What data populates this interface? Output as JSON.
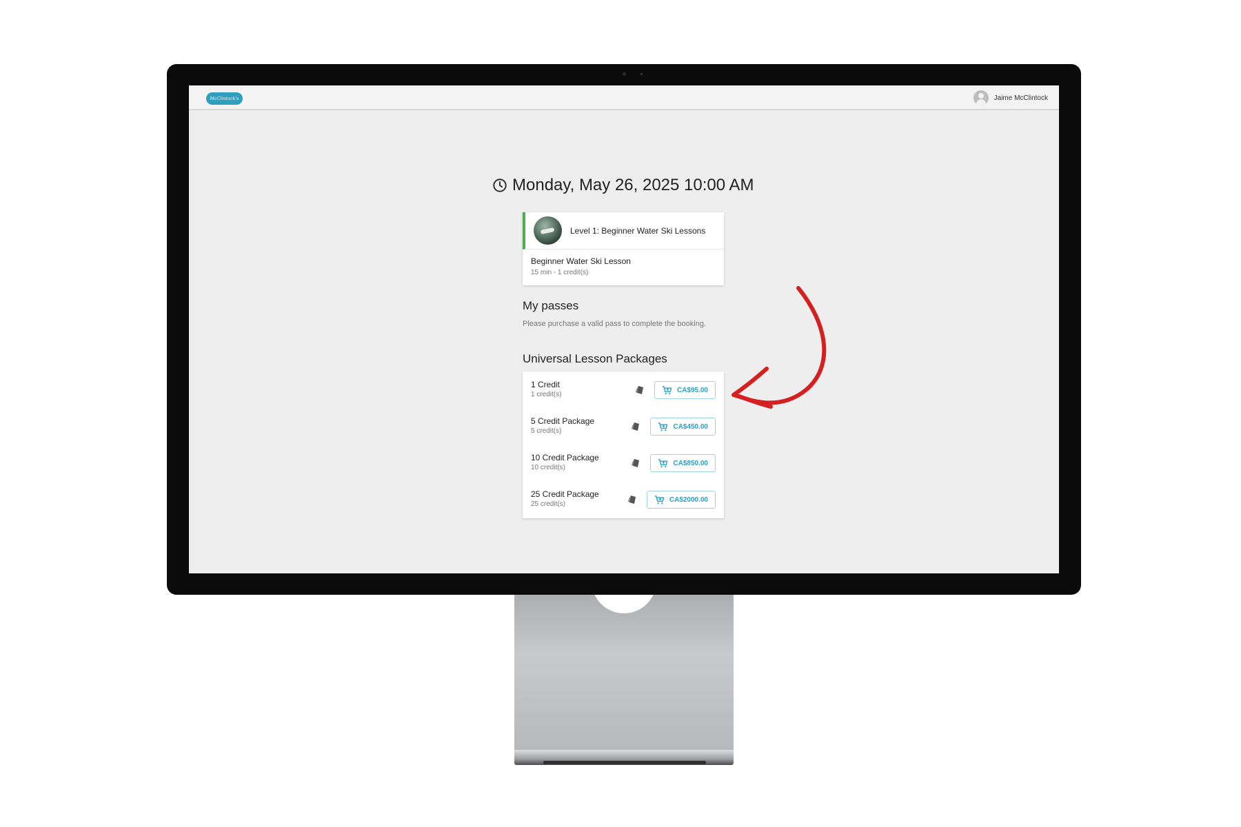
{
  "header": {
    "logo_text": "McClintock's",
    "user_name": "Jaime McClintock"
  },
  "main": {
    "date_time": "Monday, May 26, 2025 10:00 AM",
    "lesson": {
      "title": "Level 1: Beginner Water Ski Lessons",
      "name": "Beginner Water Ski Lesson",
      "meta": "15 min - 1 credit(s)"
    },
    "passes": {
      "heading": "My passes",
      "note": "Please purchase a valid pass to complete the booking."
    },
    "packages": {
      "heading": "Universal Lesson Packages",
      "items": [
        {
          "name": "1 Credit",
          "credits": "1 credit(s)",
          "price": "CA$95.00"
        },
        {
          "name": "5 Credit Package",
          "credits": "5 credit(s)",
          "price": "CA$450.00"
        },
        {
          "name": "10 Credit Package",
          "credits": "10 credit(s)",
          "price": "CA$850.00"
        },
        {
          "name": "25 Credit Package",
          "credits": "25 credit(s)",
          "price": "CA$2000.00"
        }
      ]
    }
  },
  "icons": {
    "clock": "clock-icon",
    "cart": "cart-icon",
    "tag": "tag-icon",
    "avatar": "user-avatar-icon",
    "annotation": "red-arrow-icon"
  },
  "colors": {
    "accent": "#2a9fc6",
    "lesson_bar": "#4caf50",
    "annotation": "#d42020",
    "screen_bg": "#eeeeee"
  }
}
